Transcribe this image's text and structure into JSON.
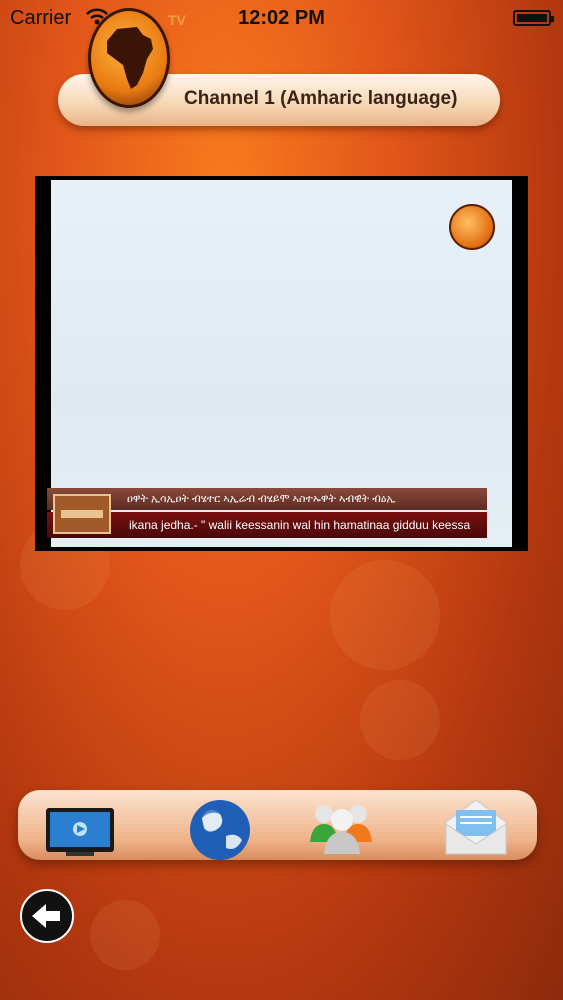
{
  "status_bar": {
    "carrier": "Carrier",
    "time": "12:02 PM"
  },
  "header": {
    "title": "Channel 1 (Amharic language)",
    "logo_tv": "TV"
  },
  "video": {
    "ticker_line_1": "ዐዋት ኢሳኢዐት ብሄተር ኣኢሬብ ብሄይሞ ኣስተኡዋት ኣብዊት ብዕኢ",
    "ticker_line_2": "ikana jedha.- \" walii keessanin wal hin hamatinaa gidduu keessa"
  },
  "dock": {
    "icons": [
      "tv-icon",
      "globe-icon",
      "users-icon",
      "mail-icon"
    ]
  },
  "colors": {
    "background": "#e2561a",
    "accent": "#f6d6b4"
  }
}
